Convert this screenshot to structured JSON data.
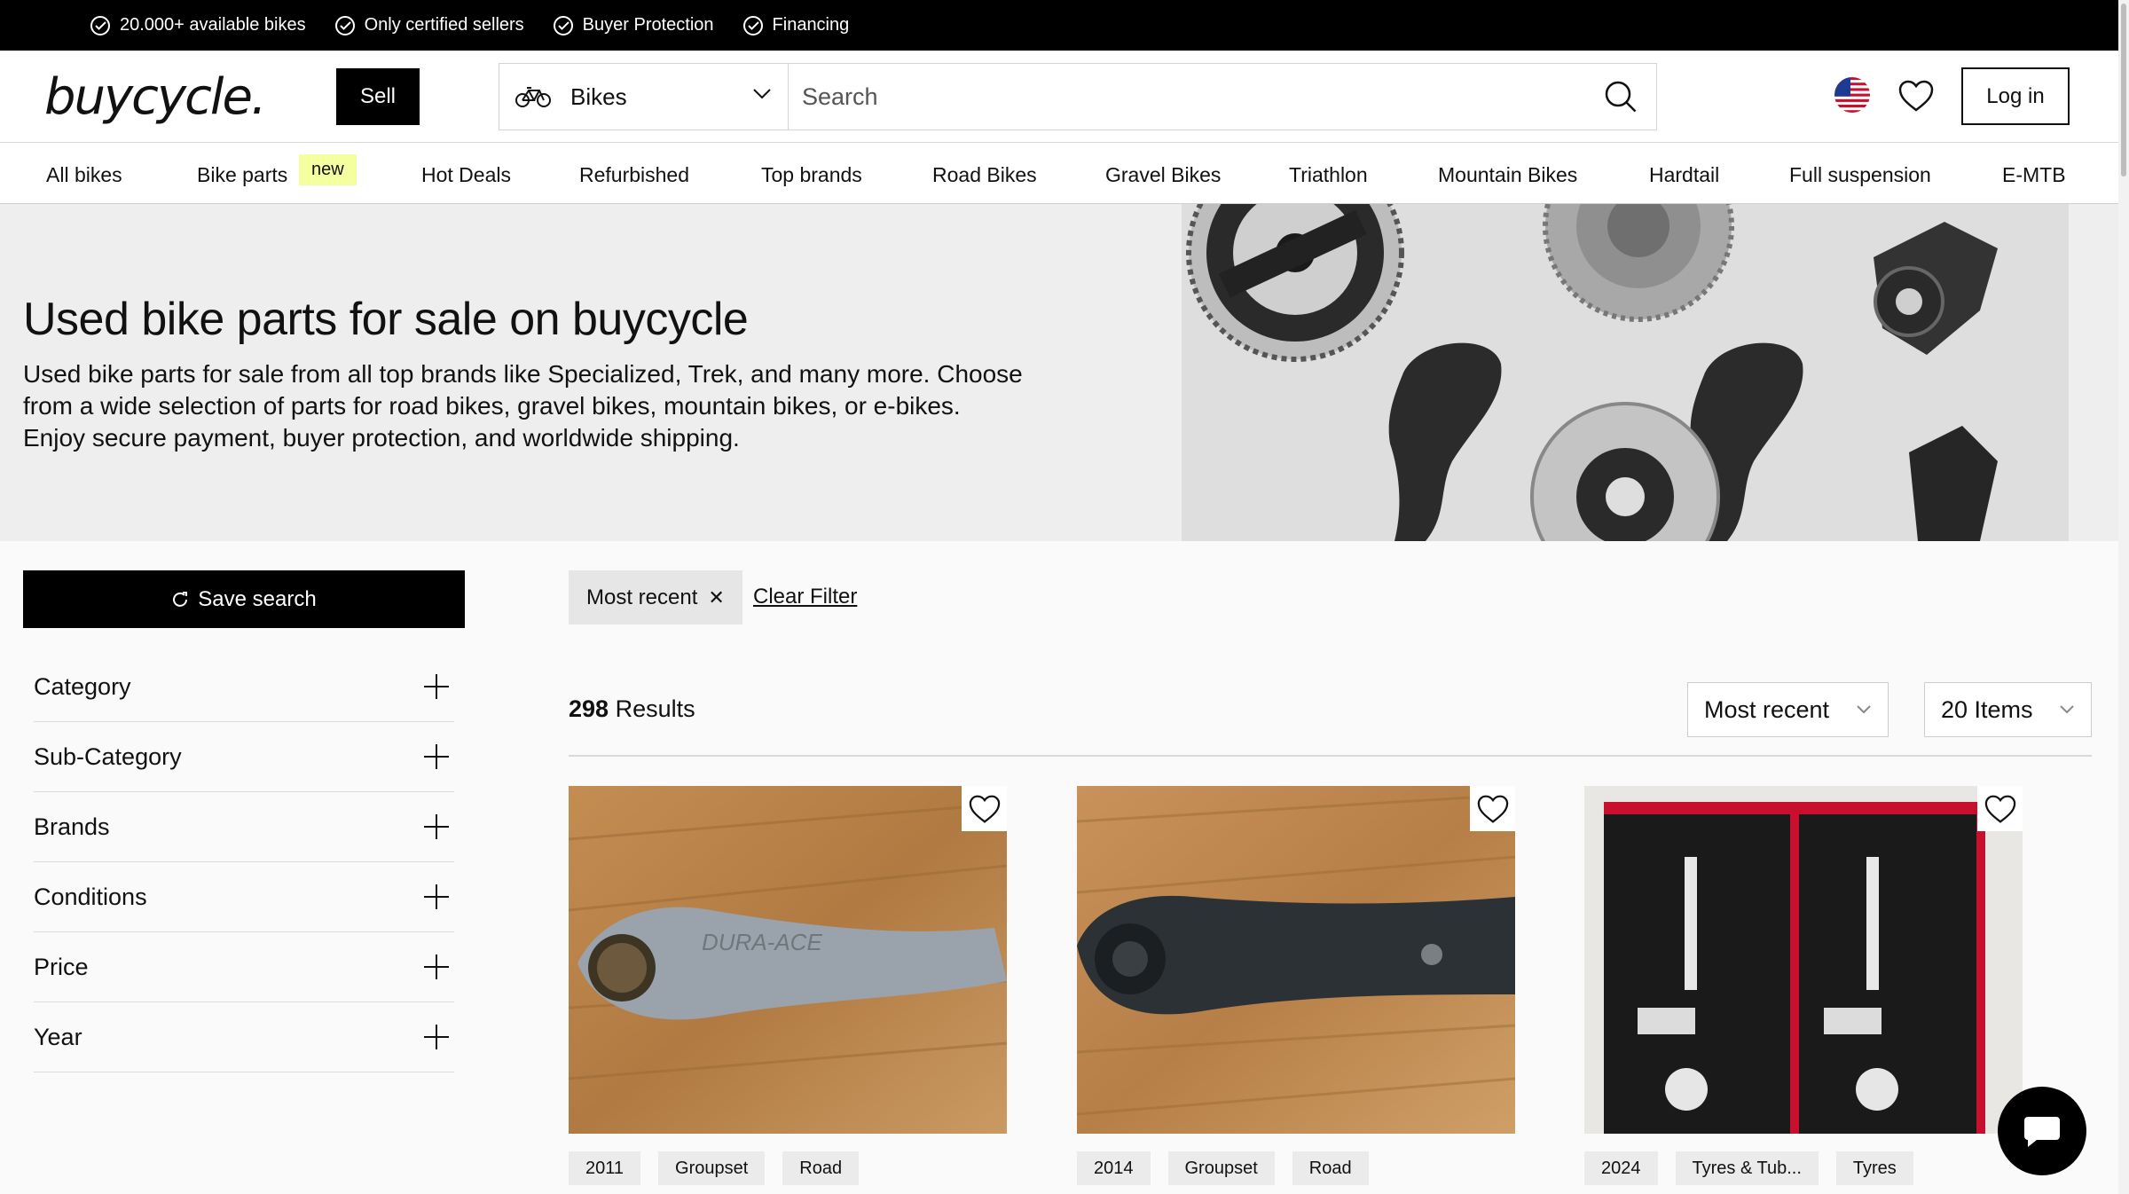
{
  "usp_bar": [
    "20.000+ available bikes",
    "Only certified sellers",
    "Buyer Protection",
    "Financing"
  ],
  "header": {
    "logo": "buycycle.",
    "sell_label": "Sell",
    "category_select": "Bikes",
    "search_placeholder": "Search",
    "login_label": "Log in"
  },
  "nav": {
    "items": [
      "All bikes",
      "Bike parts",
      "Hot Deals",
      "Refurbished",
      "Top brands",
      "Road Bikes",
      "Gravel Bikes",
      "Triathlon",
      "Mountain Bikes",
      "Hardtail",
      "Full suspension",
      "E-MTB"
    ],
    "new_badge": "new"
  },
  "hero": {
    "title": "Used bike parts for sale on buycycle",
    "description": "Used bike parts for sale from all top brands like Specialized, Trek, and many more. Choose from a wide selection of parts for road bikes, gravel bikes, mountain bikes, or e-bikes. Enjoy secure payment, buyer protection, and worldwide shipping."
  },
  "sidebar": {
    "save_search_label": "Save search",
    "filters": [
      "Category",
      "Sub-Category",
      "Brands",
      "Conditions",
      "Price",
      "Year"
    ]
  },
  "listing": {
    "active_chip": "Most recent",
    "clear_filter": "Clear Filter",
    "results_count": "298",
    "results_label": "Results",
    "sort_value": "Most recent",
    "per_page_value": "20 Items",
    "products": [
      {
        "tags": [
          "2011",
          "Groupset",
          "Road"
        ],
        "image": "crank-arm-silver"
      },
      {
        "tags": [
          "2014",
          "Groupset",
          "Road"
        ],
        "image": "crank-arm-black"
      },
      {
        "tags": [
          "2024",
          "Tyres & Tub...",
          "Tyres"
        ],
        "image": "challenge-tyres"
      }
    ]
  },
  "colors": {
    "accent": "#000000",
    "badge": "#f4ff9f",
    "background": "#fafafa"
  }
}
